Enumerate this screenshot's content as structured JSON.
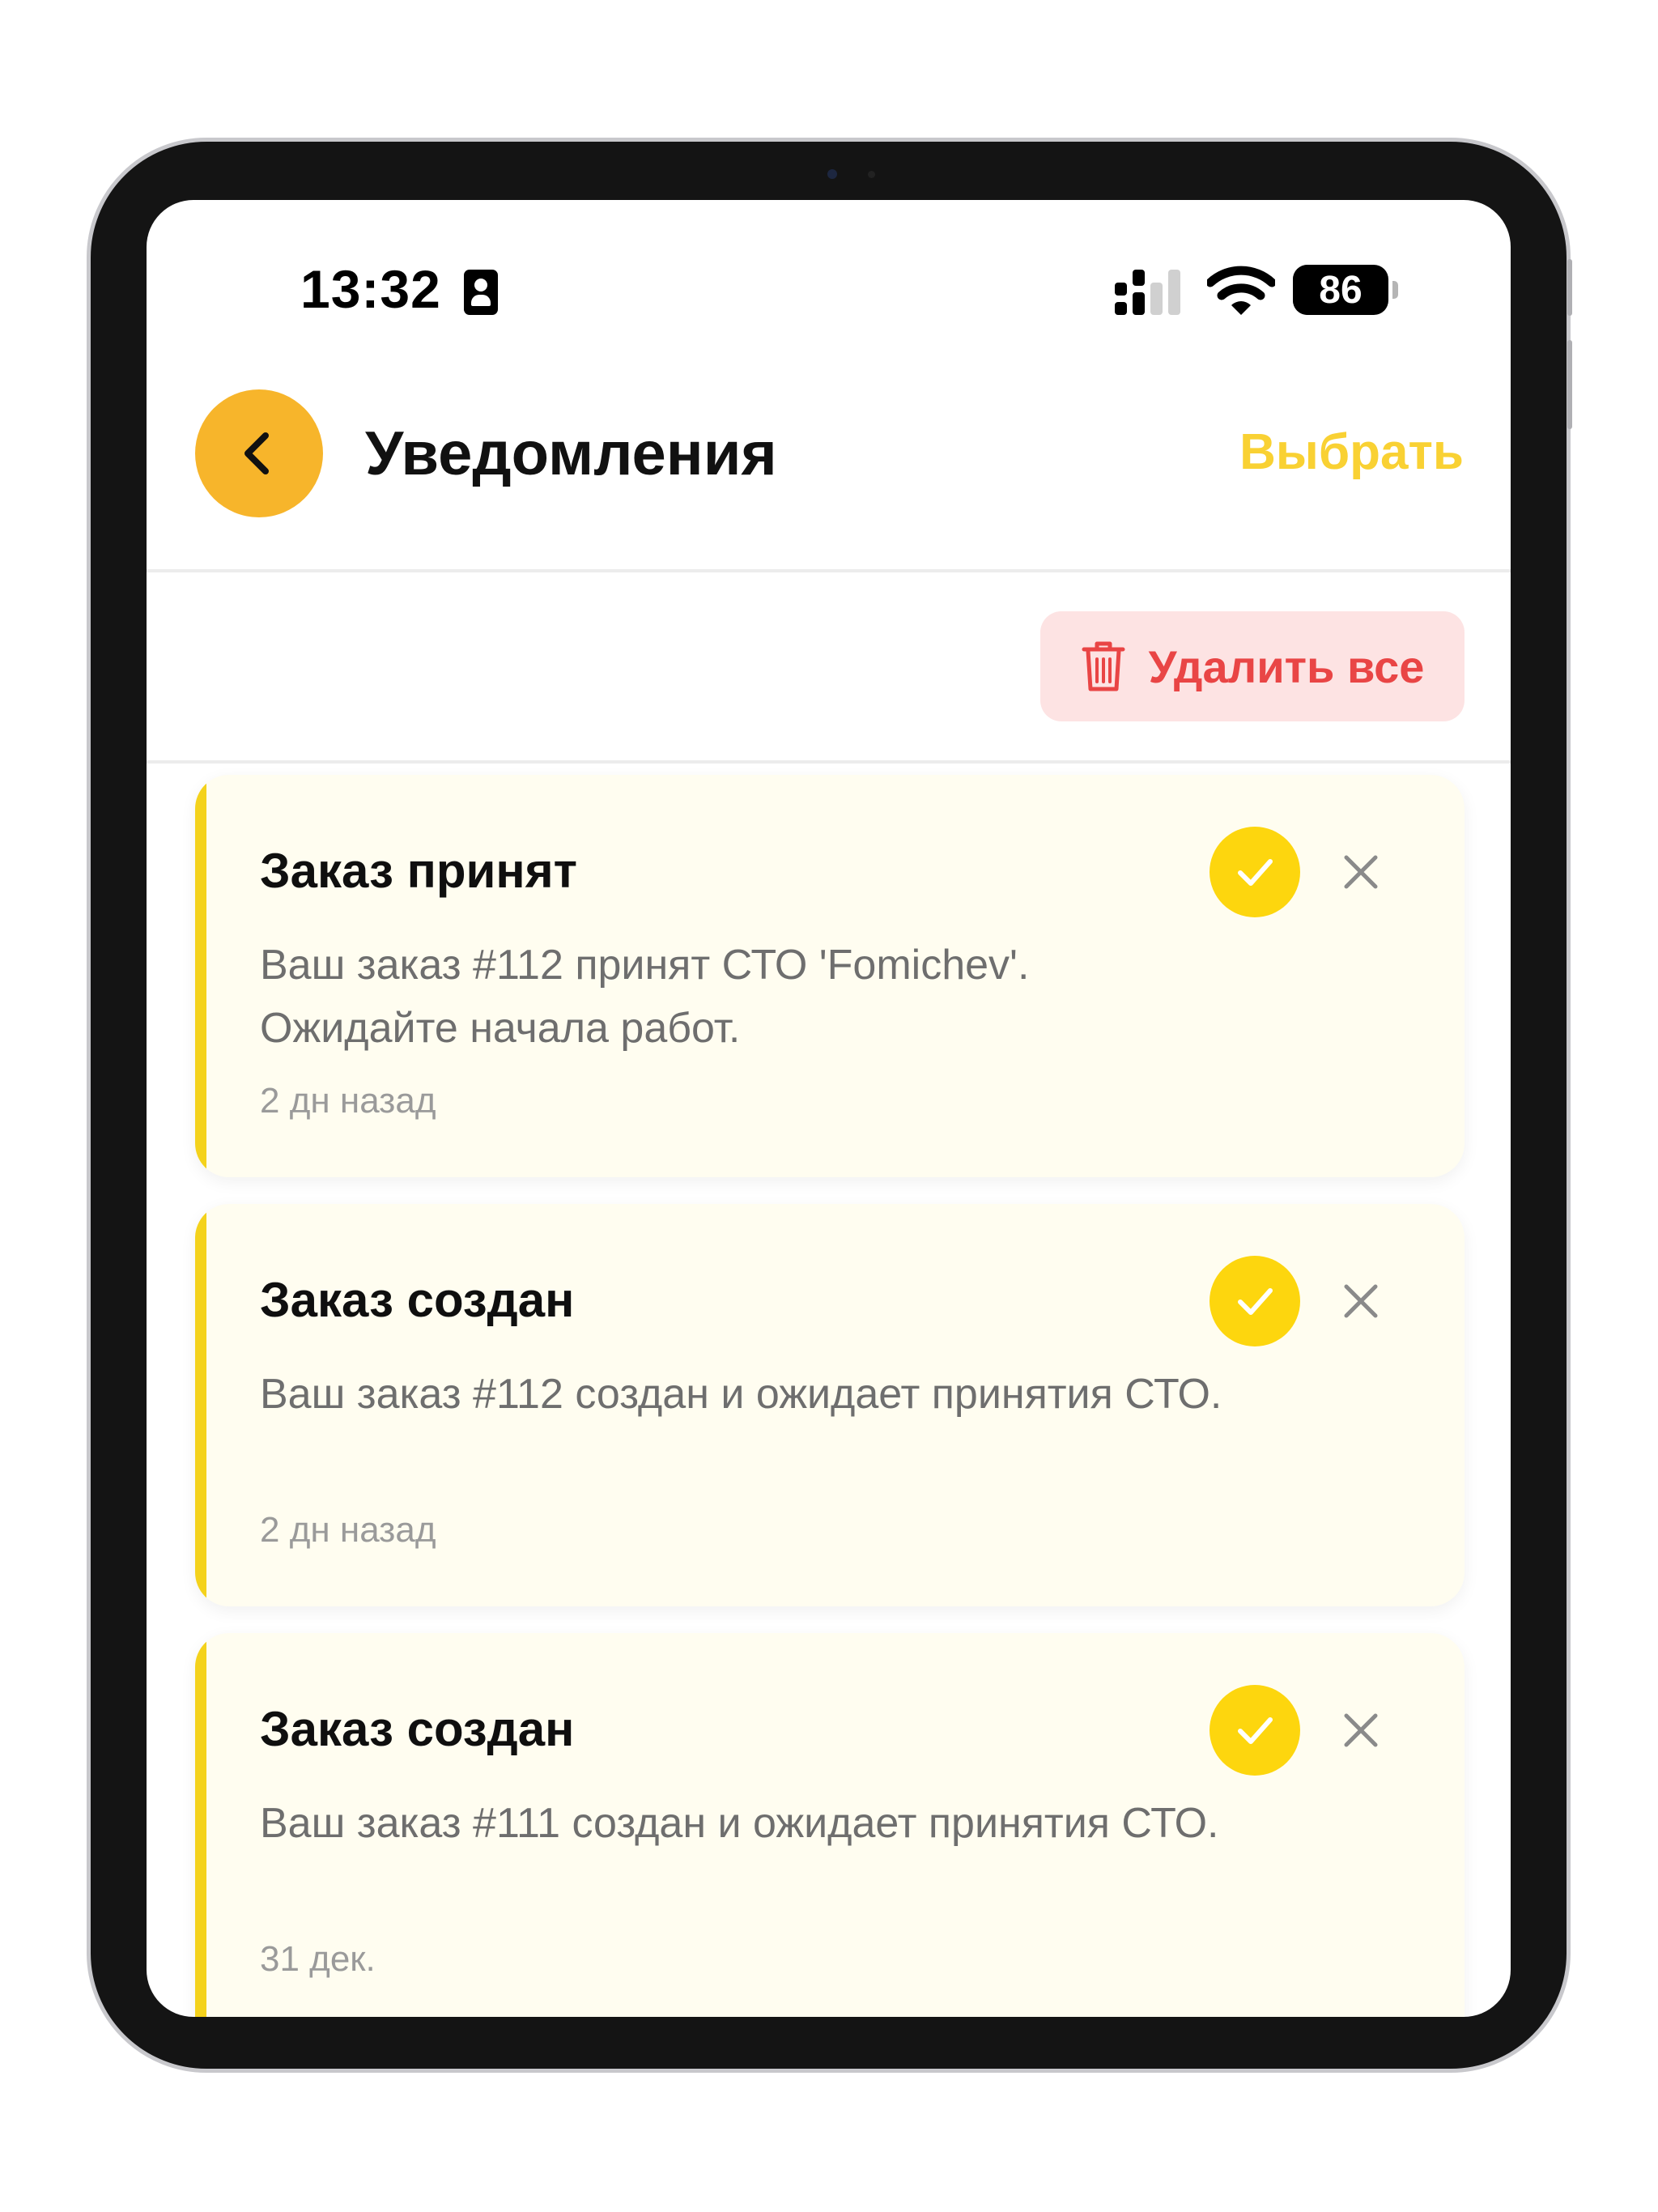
{
  "status_bar": {
    "time": "13:32",
    "battery": "86"
  },
  "header": {
    "title": "Уведомления",
    "select_label": "Выбрать"
  },
  "toolbar": {
    "delete_all_label": "Удалить все"
  },
  "notifications": [
    {
      "title": "Заказ принят",
      "body": "Ваш заказ #112 принят СТО 'Fomichev'. Ожидайте начала работ.",
      "time": "2 дн назад"
    },
    {
      "title": "Заказ создан",
      "body": "Ваш заказ #112 создан и ожидает принятия СТО.",
      "time": "2 дн назад"
    },
    {
      "title": "Заказ создан",
      "body": "Ваш заказ #111 создан и ожидает принятия СТО.",
      "time": "31 дек."
    }
  ],
  "colors": {
    "accent": "#f7b52b",
    "select": "#f9d133",
    "check": "#fdd60e",
    "danger": "#e94545",
    "danger_bg": "#fde3e3",
    "card_bg": "#fffdf0"
  }
}
